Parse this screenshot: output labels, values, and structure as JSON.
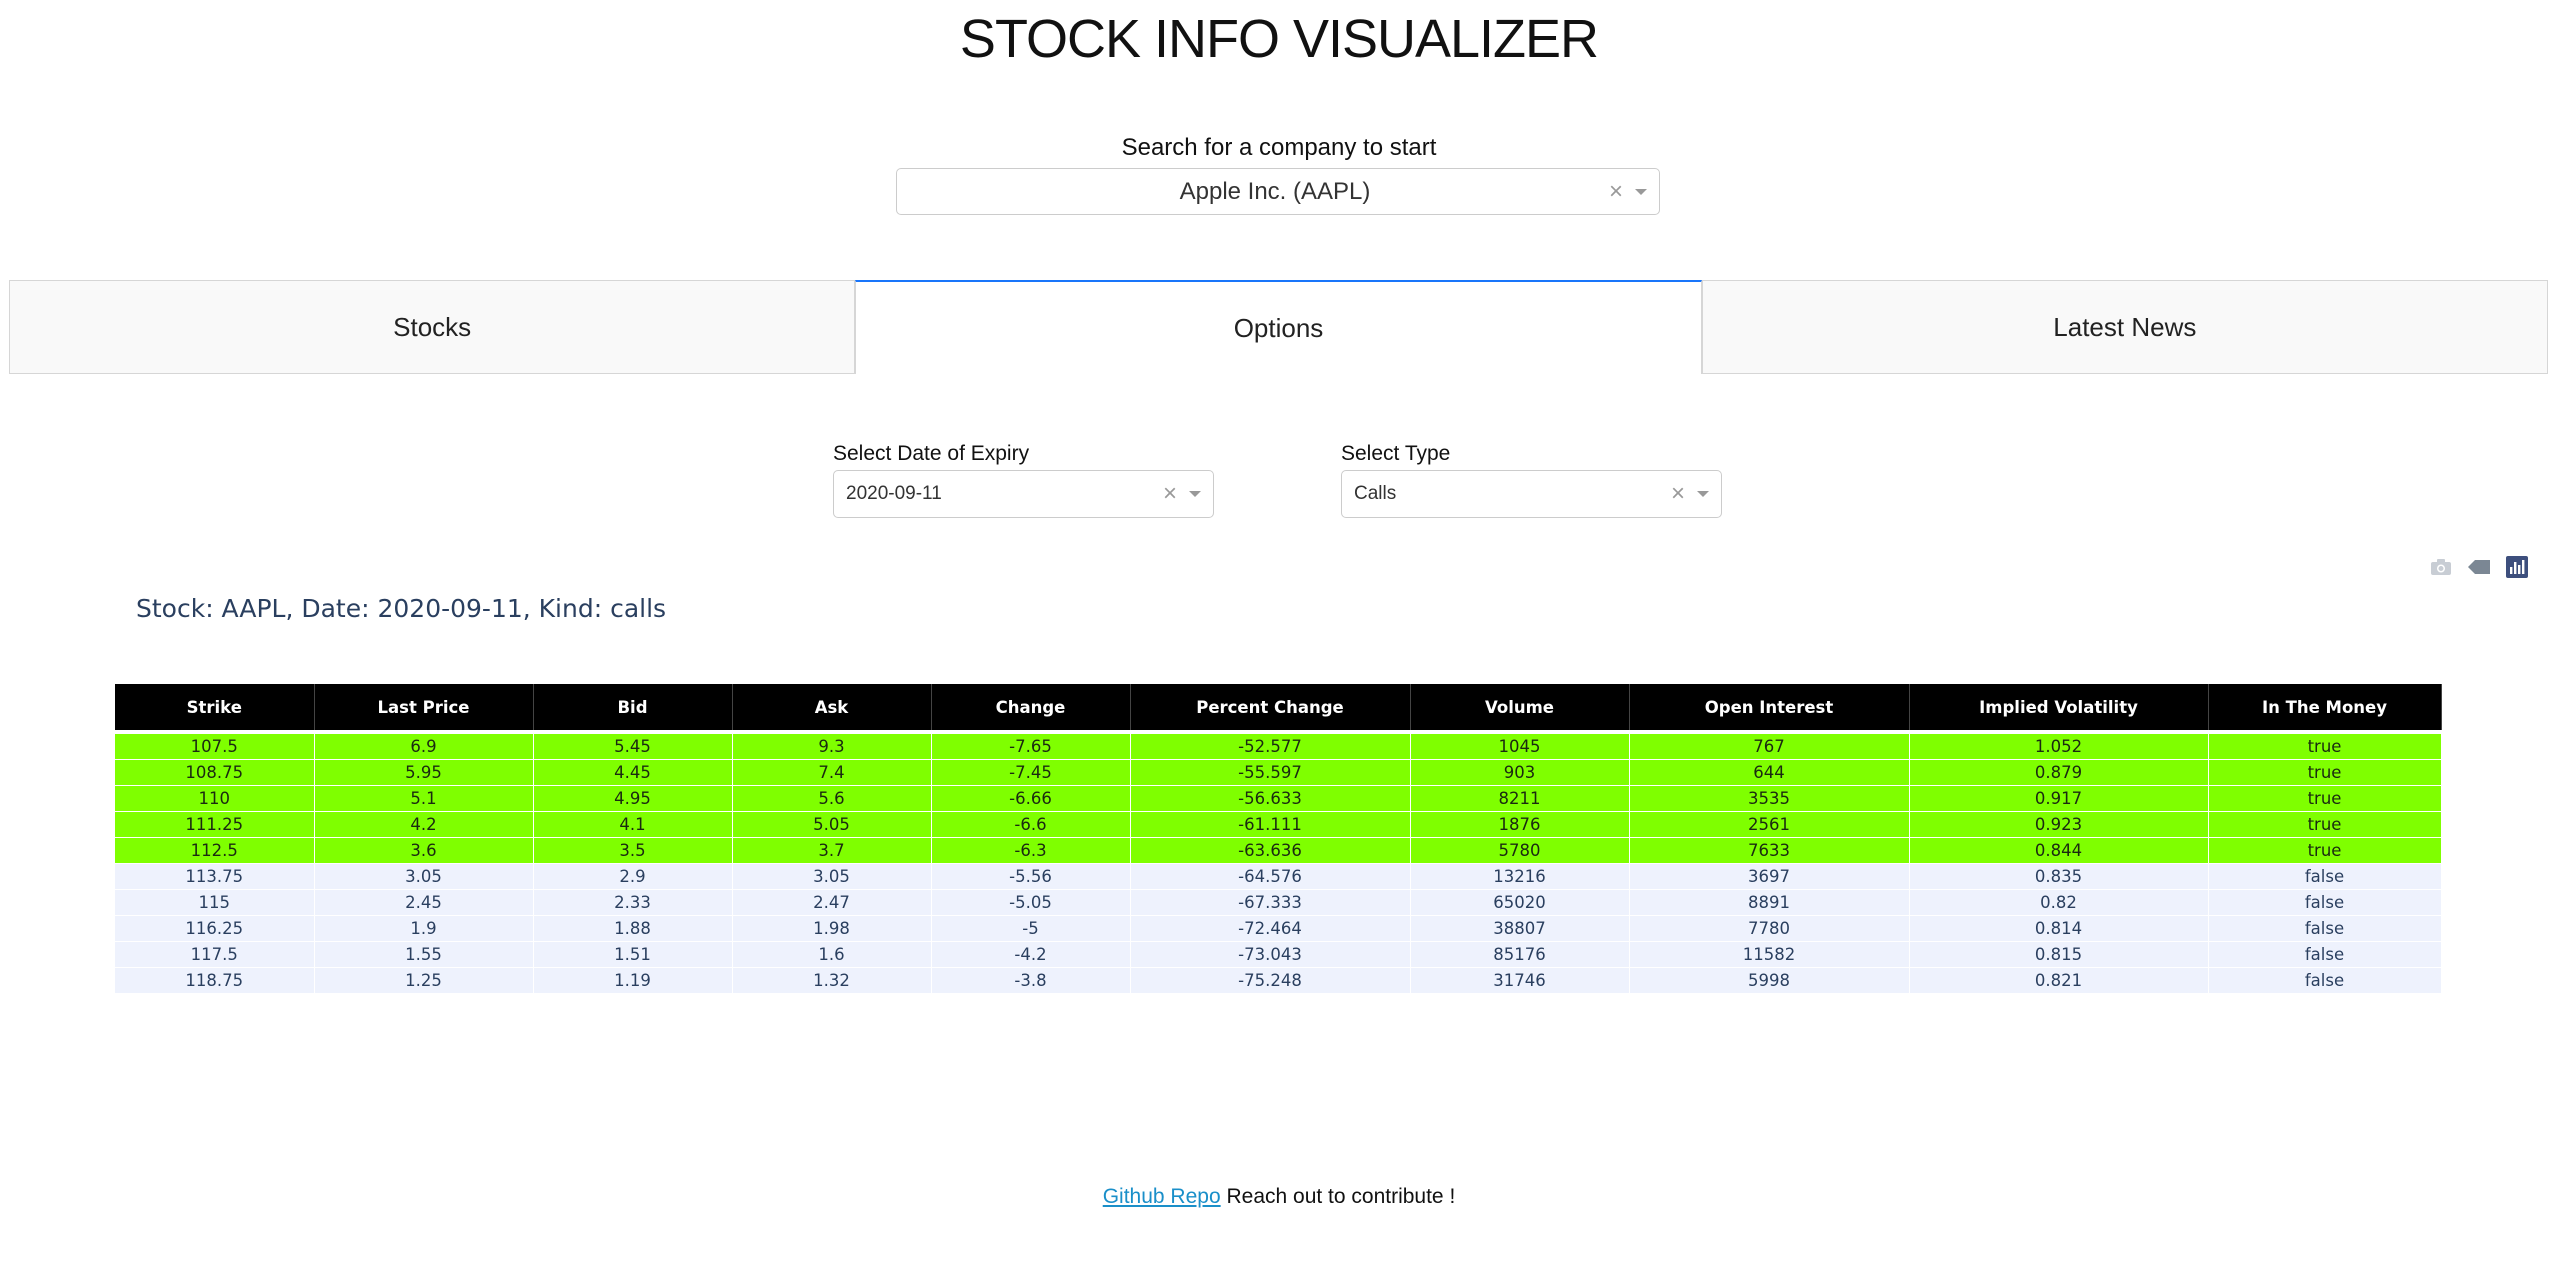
{
  "app": {
    "title": "STOCK INFO VISUALIZER",
    "search_label": "Search for a company to start",
    "company_value": "Apple Inc. (AAPL)"
  },
  "tabs": [
    {
      "label": "Stocks",
      "active": false
    },
    {
      "label": "Options",
      "active": true
    },
    {
      "label": "Latest News",
      "active": false
    }
  ],
  "filters": {
    "expiry": {
      "label": "Select Date of Expiry",
      "value": "2020-09-11"
    },
    "type": {
      "label": "Select Type",
      "value": "Calls"
    }
  },
  "modebar": {
    "icons": [
      "camera-icon",
      "tag-icon",
      "plotly-logo-icon"
    ]
  },
  "caption": "Stock: AAPL, Date: 2020-09-11, Kind: calls",
  "table": {
    "headers": [
      "Strike",
      "Last Price",
      "Bid",
      "Ask",
      "Change",
      "Percent Change",
      "Volume",
      "Open Interest",
      "Implied Volatility",
      "In The Money"
    ],
    "rows": [
      [
        "107.5",
        "6.9",
        "5.45",
        "9.3",
        "-7.65",
        "-52.577",
        "1045",
        "767",
        "1.052",
        "true"
      ],
      [
        "108.75",
        "5.95",
        "4.45",
        "7.4",
        "-7.45",
        "-55.597",
        "903",
        "644",
        "0.879",
        "true"
      ],
      [
        "110",
        "5.1",
        "4.95",
        "5.6",
        "-6.66",
        "-56.633",
        "8211",
        "3535",
        "0.917",
        "true"
      ],
      [
        "111.25",
        "4.2",
        "4.1",
        "5.05",
        "-6.6",
        "-61.111",
        "1876",
        "2561",
        "0.923",
        "true"
      ],
      [
        "112.5",
        "3.6",
        "3.5",
        "3.7",
        "-6.3",
        "-63.636",
        "5780",
        "7633",
        "0.844",
        "true"
      ],
      [
        "113.75",
        "3.05",
        "2.9",
        "3.05",
        "-5.56",
        "-64.576",
        "13216",
        "3697",
        "0.835",
        "false"
      ],
      [
        "115",
        "2.45",
        "2.33",
        "2.47",
        "-5.05",
        "-67.333",
        "65020",
        "8891",
        "0.82",
        "false"
      ],
      [
        "116.25",
        "1.9",
        "1.88",
        "1.98",
        "-5",
        "-72.464",
        "38807",
        "7780",
        "0.814",
        "false"
      ],
      [
        "117.5",
        "1.55",
        "1.51",
        "1.6",
        "-4.2",
        "-73.043",
        "85176",
        "11582",
        "0.815",
        "false"
      ],
      [
        "118.75",
        "1.25",
        "1.19",
        "1.32",
        "-3.8",
        "-75.248",
        "31746",
        "5998",
        "0.821",
        "false"
      ]
    ]
  },
  "colors": {
    "in_the_money": "#7fff00",
    "out_of_money": "#eef2fd",
    "header": "#000000",
    "active_tab_border": "#1975fa"
  },
  "footer": {
    "link_text": "Github Repo",
    "text": " Reach out to contribute !"
  }
}
